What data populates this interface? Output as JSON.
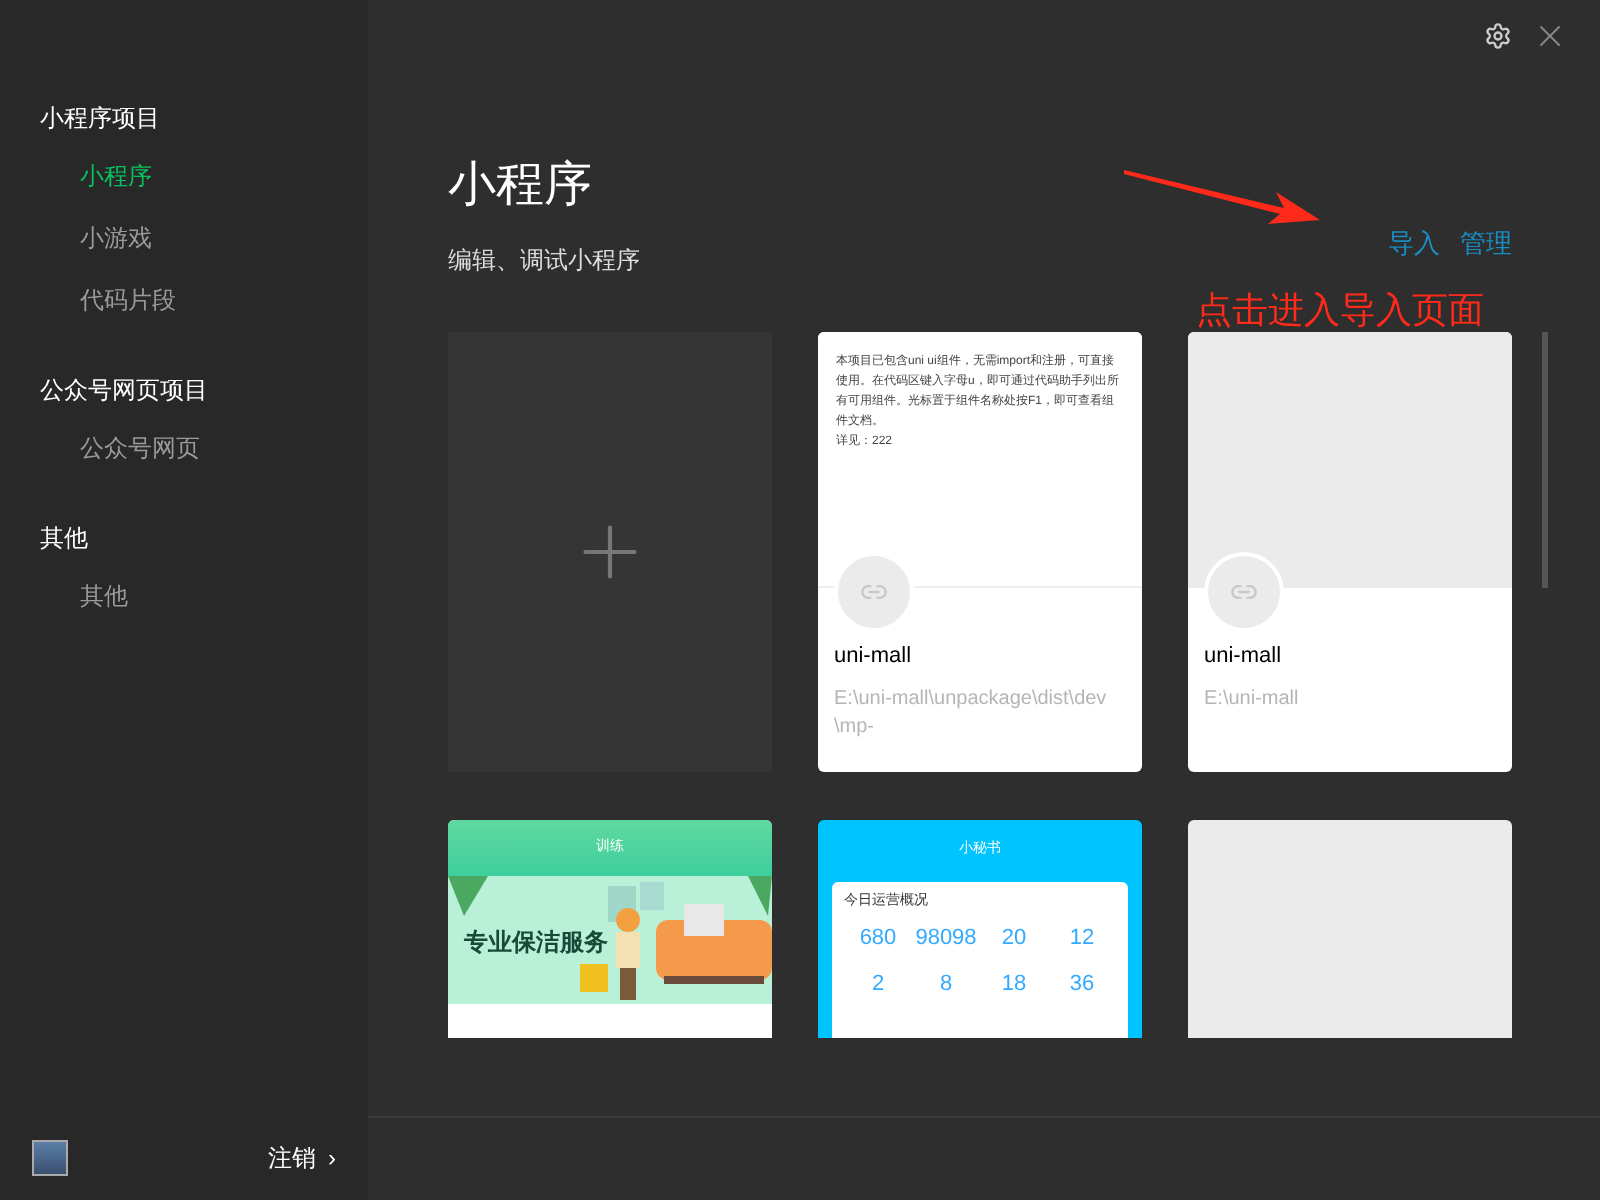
{
  "sidebar": {
    "groups": [
      {
        "title": "小程序项目",
        "items": [
          {
            "label": "小程序",
            "selected": true
          },
          {
            "label": "小游戏",
            "selected": false
          },
          {
            "label": "代码片段",
            "selected": false
          }
        ]
      },
      {
        "title": "公众号网页项目",
        "items": [
          {
            "label": "公众号网页",
            "selected": false
          }
        ]
      },
      {
        "title": "其他",
        "items": [
          {
            "label": "其他",
            "selected": false
          }
        ]
      }
    ],
    "logout": {
      "label": "注销",
      "chevron": "›"
    }
  },
  "main": {
    "title": "小程序",
    "subtitle": "编辑、调试小程序",
    "actions": [
      "导入",
      "管理"
    ],
    "annotation": "点击进入导入页面",
    "cards": [
      {
        "kind": "new"
      },
      {
        "kind": "project",
        "preview": {
          "kind": "text",
          "lines": [
            "本项目已包含uni ui组件，无需import和注册，可直接使用。在代码区键入字母u，即可通过代码助手列出所有可用组件。光标置于组件名称处按F1，即可查看组件文档。",
            "详见：222"
          ]
        },
        "name": "uni-mall",
        "path": "E:\\uni-mall\\unpackage\\dist\\dev\\mp-"
      },
      {
        "kind": "project",
        "preview": {
          "kind": "blank"
        },
        "name": "uni-mall",
        "path": "E:\\uni-mall"
      },
      {
        "kind": "app",
        "preview": {
          "kind": "cleaning",
          "header": "训练",
          "banner": "专业保洁服务"
        }
      },
      {
        "kind": "app",
        "preview": {
          "kind": "stats",
          "header": "小秘书",
          "panel": "今日运营概况",
          "values": [
            "680",
            "98098",
            "20",
            "12",
            "2",
            "8",
            "18",
            "36"
          ]
        }
      },
      {
        "kind": "app",
        "preview": {
          "kind": "blank"
        }
      }
    ]
  }
}
